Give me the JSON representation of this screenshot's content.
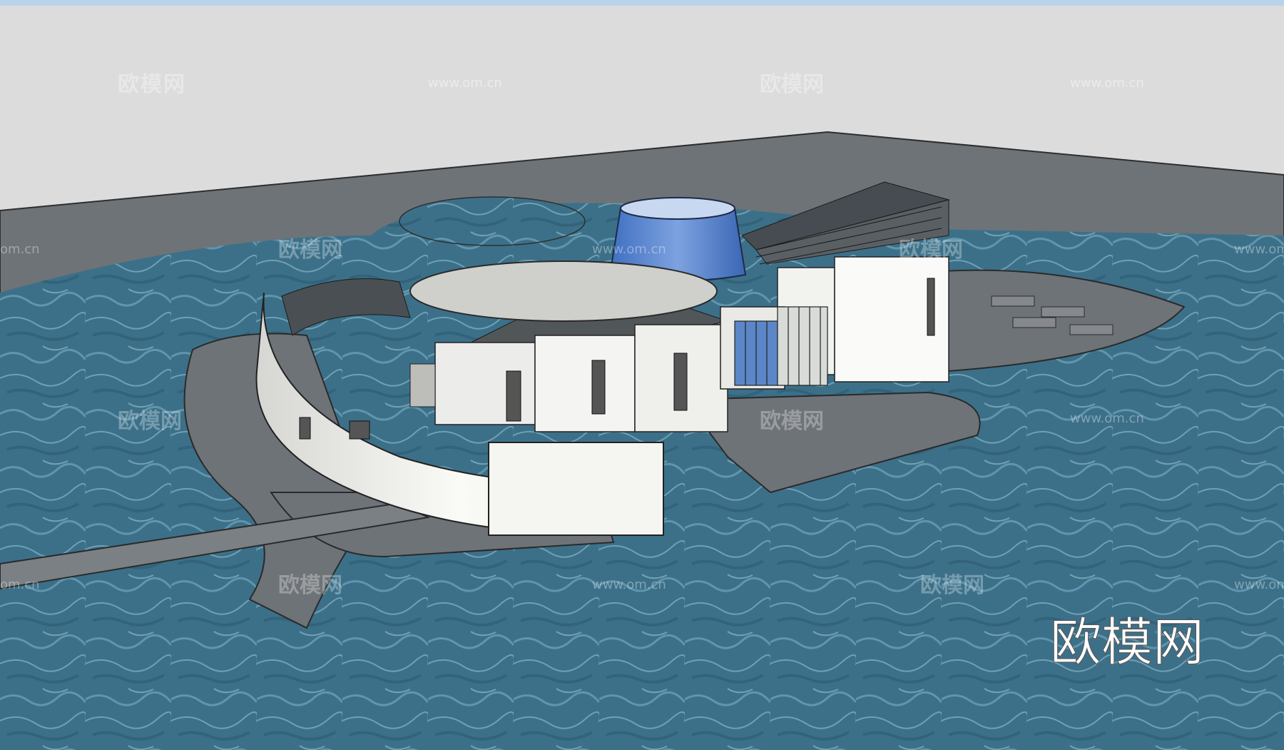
{
  "watermarks": {
    "brand": "欧模网",
    "url": "www.om.cn",
    "url_short": "om.cn",
    "url_partial": "www.om.cn"
  },
  "colors": {
    "sky": "#dcdcdc",
    "ground": "#6e7378",
    "water": "#3a6f86",
    "building": "#f2f2ee",
    "glass": "#5c87c9"
  }
}
